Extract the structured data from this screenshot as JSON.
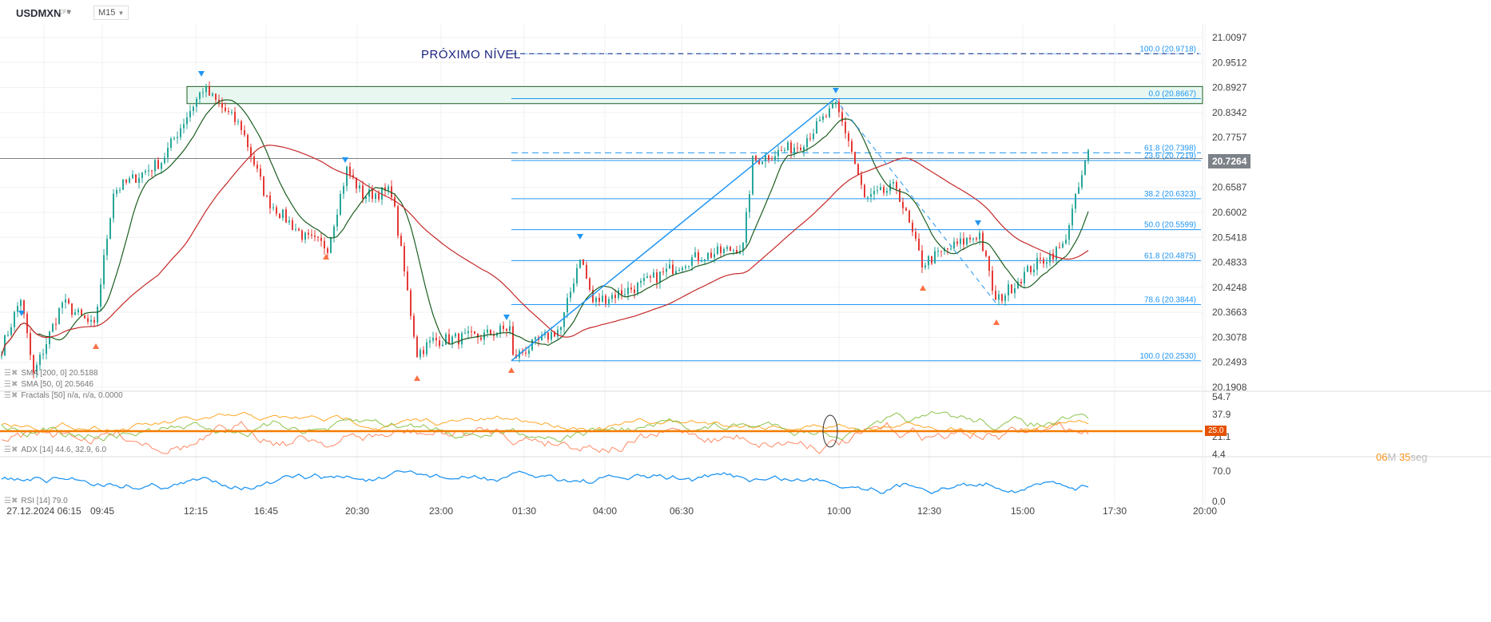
{
  "header": {
    "symbol": "USDMXN",
    "type": "CFD",
    "timeframe": "M15"
  },
  "annotation": "PRÓXIMO NÍVEL",
  "current_price": "20.7264",
  "timer": {
    "min": "06",
    "min_unit": "M",
    "sec": "35",
    "sec_unit": "seg"
  },
  "colors": {
    "up": "#26a69a",
    "down": "#e53935",
    "sma50": "#1b5e20",
    "sma200": "#c62828",
    "fib": "#2196f3",
    "adx": "#f57c00"
  },
  "legend": {
    "sma200": "SMA [200, 0] 20.5188",
    "sma50": "SMA [50, 0] 20.5646",
    "fractals": "Fractals [50] n/a, n/a, 0.0000",
    "adx": "ADX [14] 44.6, 32.9, 6.0",
    "rsi": "RSI [14] 79.0"
  },
  "chart_data": {
    "type": "candlestick",
    "price_axis": [
      "21.0097",
      "20.9512",
      "20.8927",
      "20.8342",
      "20.7757",
      "20.6587",
      "20.6002",
      "20.5418",
      "20.4833",
      "20.4248",
      "20.3663",
      "20.3078",
      "20.2493",
      "20.1908"
    ],
    "ylim": [
      20.1908,
      21.0097
    ],
    "time_axis": [
      "27.12.2024 06:15",
      "09:45",
      "12:15",
      "16:45",
      "20:30",
      "23:00",
      "01:30",
      "04:00",
      "06:30",
      "10:00",
      "12:30",
      "15:00",
      "17:30",
      "20:00"
    ],
    "price_path": [
      [
        0,
        20.28
      ],
      [
        6,
        20.4
      ],
      [
        10,
        20.22
      ],
      [
        19,
        20.39
      ],
      [
        29,
        20.33
      ],
      [
        35,
        20.65
      ],
      [
        50,
        20.72
      ],
      [
        59,
        20.84
      ],
      [
        63,
        20.89
      ],
      [
        75,
        20.8
      ],
      [
        83,
        20.63
      ],
      [
        95,
        20.54
      ],
      [
        102,
        20.52
      ],
      [
        108,
        20.7
      ],
      [
        113,
        20.64
      ],
      [
        122,
        20.65
      ],
      [
        130,
        20.27
      ],
      [
        135,
        20.3
      ],
      [
        150,
        20.31
      ],
      [
        159,
        20.33
      ],
      [
        160,
        20.26
      ],
      [
        175,
        20.33
      ],
      [
        181,
        20.5
      ],
      [
        185,
        20.39
      ],
      [
        200,
        20.43
      ],
      [
        215,
        20.49
      ],
      [
        232,
        20.52
      ],
      [
        235,
        20.72
      ],
      [
        250,
        20.76
      ],
      [
        261,
        20.85
      ],
      [
        265,
        20.77
      ],
      [
        270,
        20.63
      ],
      [
        280,
        20.66
      ],
      [
        288,
        20.48
      ],
      [
        295,
        20.51
      ],
      [
        306,
        20.55
      ],
      [
        311,
        20.39
      ],
      [
        322,
        20.47
      ],
      [
        332,
        20.52
      ],
      [
        336,
        20.63
      ],
      [
        340,
        20.74
      ]
    ],
    "fib_levels": [
      {
        "label": "0.0 (20.8667)",
        "price": 20.8667,
        "dash": false
      },
      {
        "label": "23.6 (20.7219)",
        "price": 20.7219,
        "dash": false
      },
      {
        "label": "38.2 (20.6323)",
        "price": 20.6323,
        "dash": false
      },
      {
        "label": "50.0 (20.5599)",
        "price": 20.5599,
        "dash": false
      },
      {
        "label": "61.8 (20.4875)",
        "price": 20.4875,
        "dash": false
      },
      {
        "label": "78.6 (20.3844)",
        "price": 20.3844,
        "dash": false
      },
      {
        "label": "100.0 (20.2530)",
        "price": 20.253,
        "dash": false
      },
      {
        "label": "61.8 (20.7398)",
        "price": 20.7398,
        "dash": true
      },
      {
        "label": "100.0 (20.9718)",
        "price": 20.9718,
        "dash": true
      }
    ],
    "zone": [
      20.855,
      20.895
    ],
    "adx_axis": [
      "54.7",
      "37.9",
      "21.1",
      "4.4"
    ],
    "adx_level": "25.0",
    "rsi_axis": [
      "70.0",
      "0.0"
    ]
  }
}
